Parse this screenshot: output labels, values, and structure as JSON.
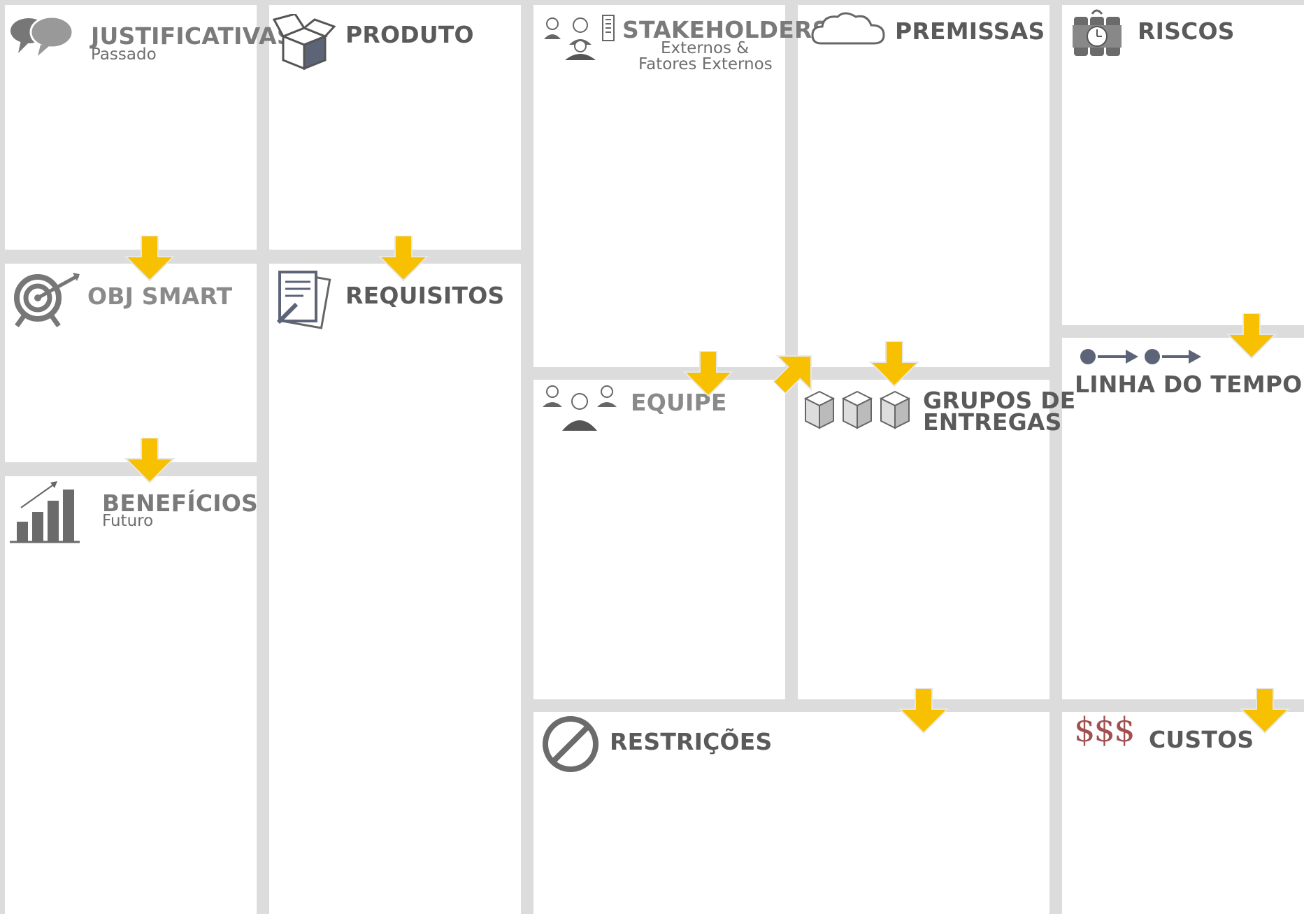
{
  "canvas": {
    "justificativas": {
      "title": "JUSTIFICATIVAS",
      "subtitle": "Passado"
    },
    "obj_smart": {
      "title": "OBJ SMART"
    },
    "beneficios": {
      "title": "BENEFÍCIOS",
      "subtitle": "Futuro"
    },
    "produto": {
      "title": "PRODUTO"
    },
    "requisitos": {
      "title": "REQUISITOS"
    },
    "stakeholders": {
      "title": "STAKEHOLDERS",
      "subtitle_line1": "Externos &",
      "subtitle_line2": "Fatores Externos"
    },
    "equipe": {
      "title": "EQUIPE"
    },
    "premissas": {
      "title": "PREMISSAS"
    },
    "grupos_entregas": {
      "title_line1": "GRUPOS DE",
      "title_line2": "ENTREGAS"
    },
    "restricoes": {
      "title": "RESTRIÇÕES"
    },
    "riscos": {
      "title": "RISCOS"
    },
    "linha_do_tempo": {
      "title": "LINHA DO TEMPO"
    },
    "custos": {
      "title": "CUSTOS",
      "icon_text": "$$$"
    }
  },
  "colors": {
    "arrow": "#f7c000",
    "background": "#dcdcdc",
    "panel": "#ffffff",
    "icon": "#6b6b6b",
    "cost_icon": "#a05050"
  }
}
